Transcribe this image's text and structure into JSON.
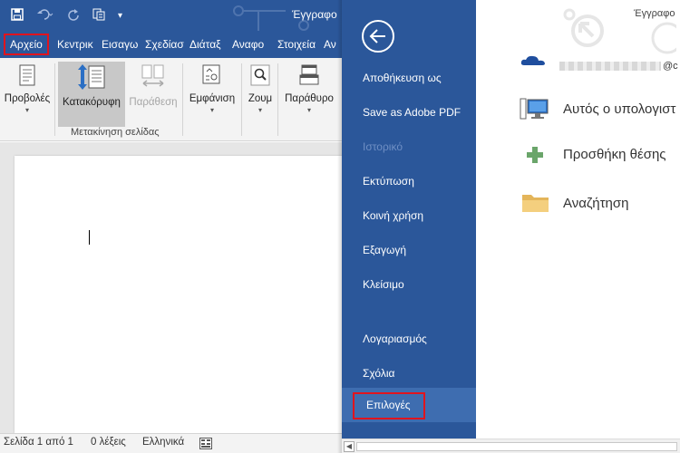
{
  "titlebar": {
    "document_title_left": "Έγγραφο",
    "document_title_right": "Έγγραφο",
    "customize_caret": "▾"
  },
  "tabs": [
    {
      "label": "Αρχείο"
    },
    {
      "label": "Κεντρικ"
    },
    {
      "label": "Εισαγω"
    },
    {
      "label": "Σχεδίασ"
    },
    {
      "label": "Διάταξ"
    },
    {
      "label": "Αναφο"
    },
    {
      "label": "Στοιχεία"
    },
    {
      "label": "Αν"
    }
  ],
  "ribbon": {
    "views_label": "Προβολές",
    "vertical_label": "Κατακόρυφη",
    "side_by_side_label": "Παράθεση",
    "show_label": "Εμφάνιση",
    "zoom_label": "Ζουμ",
    "window_label": "Παράθυρο",
    "page_movement_group": "Μετακίνηση σελίδας",
    "caret": "▾"
  },
  "status": {
    "page": "Σελίδα 1 από 1",
    "words": "0 λέξεις",
    "language": "Ελληνικά"
  },
  "backstage": {
    "nav": [
      {
        "label": "Αποθήκευση ως",
        "disabled": false
      },
      {
        "label": "Save as Adobe PDF",
        "disabled": false
      },
      {
        "label": "Ιστορικό",
        "disabled": true
      },
      {
        "label": "Εκτύπωση",
        "disabled": false
      },
      {
        "label": "Κοινή χρήση",
        "disabled": false
      },
      {
        "label": "Εξαγωγή",
        "disabled": false
      },
      {
        "label": "Κλείσιμο",
        "disabled": false
      },
      {
        "label": "Λογαριασμός",
        "disabled": false
      },
      {
        "label": "Σχόλια",
        "disabled": false
      },
      {
        "label": "Επιλογές",
        "disabled": false
      }
    ],
    "account_email_suffix": "@c",
    "places": [
      {
        "label": "Αυτός ο υπολογιστ",
        "icon": "computer-icon"
      },
      {
        "label": "Προσθήκη θέσης",
        "icon": "plus-icon"
      },
      {
        "label": "Αναζήτηση",
        "icon": "folder-icon"
      }
    ]
  },
  "colors": {
    "word_blue": "#2b579a",
    "highlight_red": "#e0141e",
    "selected_nav": "#3e6db0"
  }
}
